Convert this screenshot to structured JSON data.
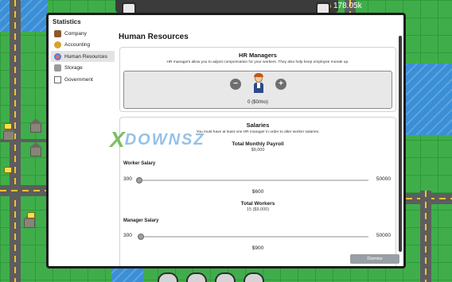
{
  "hud": {
    "money": "178.05k",
    "icons": [
      "coin-icon",
      "storage-hud-icon",
      "camera-hud-icon"
    ]
  },
  "modal": {
    "title": "Statistics",
    "sidebar": [
      {
        "label": "Company",
        "icon": "briefcase-icon",
        "active": false
      },
      {
        "label": "Accounting",
        "icon": "coins-icon",
        "active": false
      },
      {
        "label": "Human Resources",
        "icon": "people-icon",
        "active": true
      },
      {
        "label": "Storage",
        "icon": "warehouse-icon",
        "active": false
      },
      {
        "label": "Government",
        "icon": "government-icon",
        "active": false
      }
    ],
    "page_title": "Human Resources",
    "hr_managers": {
      "heading": "HR Managers",
      "description": "HR managers allow you to adjust compensation for your workers. They also help keep employee morale up.",
      "count_text": "0 ($0/mo)",
      "decrease_label": "−",
      "increase_label": "+"
    },
    "salaries": {
      "heading": "Salaries",
      "description": "You must have at least one HR manager in order to alter worker salaries.",
      "total_payroll_label": "Total Monthly Payroll",
      "total_payroll_value": "$9,000",
      "worker_salary_label": "Worker Salary",
      "worker_min": "300",
      "worker_max": "50000",
      "worker_value": "$600",
      "worker_value_num": 600,
      "total_workers_label": "Total Workers",
      "total_workers_value": "15 ($9,000)",
      "manager_salary_label": "Manager Salary",
      "manager_min": "300",
      "manager_max": "50000",
      "manager_value": "$900",
      "manager_value_num": 900
    },
    "dismiss_label": "Dismiss"
  },
  "watermark": {
    "x": "X",
    "text": "DOWNSZ"
  },
  "colors": {
    "accent_blue": "#3a8fd6",
    "grass": "#3fae4a",
    "dismiss": "#9a9fa5"
  }
}
